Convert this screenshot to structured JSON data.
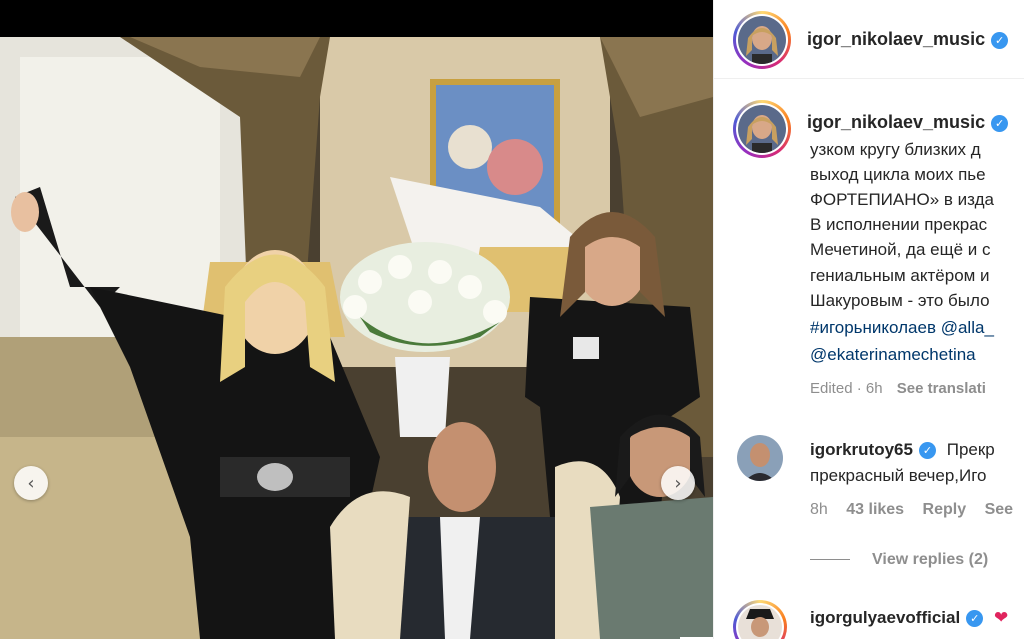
{
  "post": {
    "author": "igor_nikolaev_music",
    "prev_icon": "chevron-left-icon",
    "next_icon": "chevron-right-icon"
  },
  "caption": {
    "author": "igor_nikolaev_music",
    "lines": [
      "узком кругу близких д",
      "выход цикла моих пье",
      "ФОРТЕПИАНО» в изда",
      "В исполнении прекрас",
      "Мечетиной, да ещё и с",
      "гениальным актёром и",
      "Шакуровым - это было"
    ],
    "hashtags_line": "#игорьниколаев @alla_",
    "mention_line": "@ekaterinamechetina",
    "edited": "Edited · 6h",
    "see_translation": "See translati"
  },
  "comments": [
    {
      "username": "igorkrutoy65",
      "text_1": "Прекр",
      "text_2": "прекрасный вечер,Иго",
      "time": "8h",
      "likes": "43 likes",
      "reply": "Reply",
      "see": "See",
      "view_replies": "View replies (2)"
    },
    {
      "username": "igorgulyaevofficial",
      "text_1": "❤"
    }
  ],
  "colors": {
    "verified": "#3897f0",
    "link": "#00376b",
    "muted": "#8e8e8e"
  }
}
